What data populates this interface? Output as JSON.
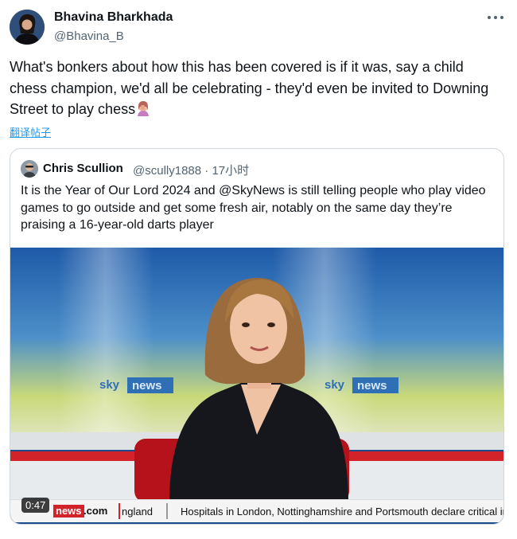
{
  "tweet": {
    "author_name": "Bhavina Bharkhada",
    "author_handle": "@Bhavina_B",
    "text": "What's bonkers about how this has been covered is if it was, say a child chess champion, we'd all be celebrating - they'd even be invited to Downing Street to play chess",
    "emoji_icon": "woman-facepalming",
    "translate_label": "翻译帖子",
    "more_icon": "more-dots-icon"
  },
  "quoted": {
    "author_name": "Chris Scullion",
    "author_handle": "@scully1888",
    "separator": "·",
    "time": "17小时",
    "text": "It is the Year of Our Lord 2024 and @SkyNews is still telling people who play video games to go outside and get some fresh air, notably on the same day they’re praising a 16-year-old darts player"
  },
  "video": {
    "duration": "0:47",
    "backdrop_logo_sky": "sky",
    "backdrop_logo_news": "news",
    "ticker_brand": "news",
    "ticker_domain": ".com",
    "ticker_region": "ngland",
    "ticker_headline": "Hospitals in London, Nottinghamshire and Portsmouth declare critical incid"
  },
  "colors": {
    "link": "#1d9bf0",
    "secondary_text": "#536471",
    "border": "#cfd9de",
    "sky_red": "#d2232a"
  }
}
